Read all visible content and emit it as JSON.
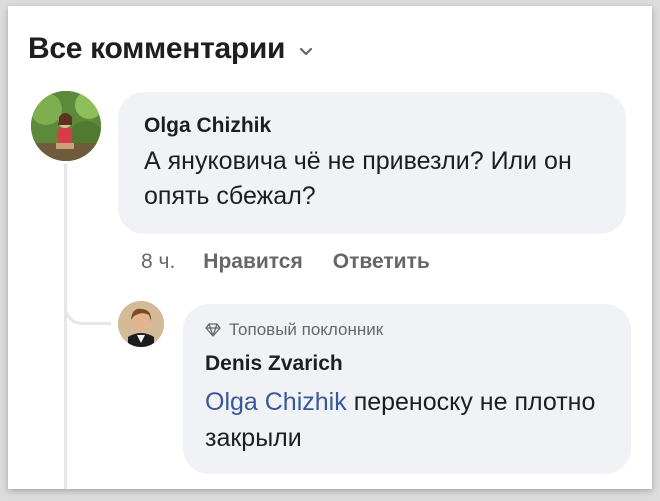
{
  "header": {
    "title": "Все комментарии",
    "chevron_icon": "chevron-down-icon"
  },
  "comments": [
    {
      "author": "Olga Chizhik",
      "text": "А януковича чё не привезли? Или он опять сбежал?",
      "time": "8 ч.",
      "like_label": "Нравится",
      "reply_label": "Ответить"
    }
  ],
  "replies": [
    {
      "badge_icon": "gem-icon",
      "badge_label": "Топовый поклонник",
      "author": "Denis Zvarich",
      "mention": "Olga Chizhik",
      "text": "переноску не плотно закрыли"
    }
  ],
  "colors": {
    "mention": "#385898",
    "bubble": "#f0f2f5",
    "secondary_text": "#65676b"
  }
}
